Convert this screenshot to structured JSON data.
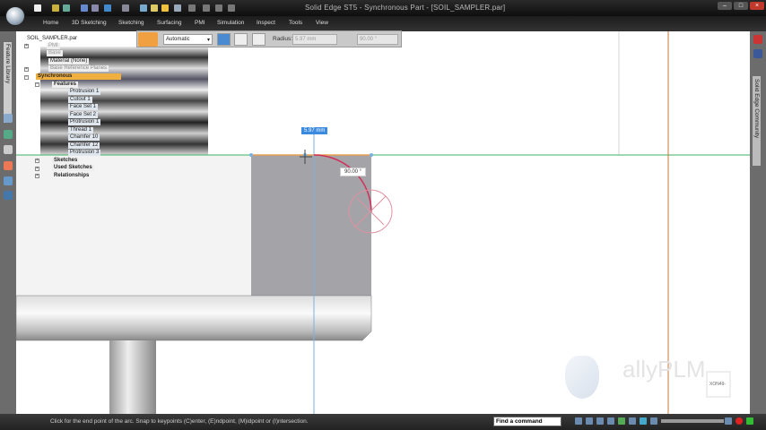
{
  "window": {
    "title": "Solid Edge ST5 - Synchronous Part - [SOIL_SAMPLER.par]"
  },
  "ribbon": {
    "tabs": [
      "Home",
      "3D Sketching",
      "Sketching",
      "Surfacing",
      "PMI",
      "Simulation",
      "Inspect",
      "Tools",
      "View"
    ]
  },
  "command_bar": {
    "mode": "Automatic",
    "radius_label": "Radius:",
    "radius_value": "5.97 mm",
    "angle_value": "90.00 °"
  },
  "left_panel": {
    "tab_label": "Feature Library"
  },
  "right_panel": {
    "tab_label": "Solid Edge Community"
  },
  "tree": {
    "root": "SOIL_SAMPLER.par",
    "pmi": "PMI",
    "base": "Base",
    "material": "Material (None)",
    "ref_planes": "Base Reference Planes",
    "synchronous": "Synchronous",
    "features": "Features",
    "feature_items": [
      "Protrusion 1",
      "Cutout 1",
      "Face Set 1",
      "Face Set 2",
      "Protrusion 1",
      "Thread 1",
      "Chamfer 10",
      "Chamfer 12",
      "Protrusion 3"
    ],
    "sketches": "Sketches",
    "used_sketches": "Used Sketches",
    "relationships": "Relationships"
  },
  "viewport": {
    "dim_radius": "5.97 mm",
    "dim_angle": "90.00 °",
    "watermark": "allyPLM",
    "view_cube": "XON49-"
  },
  "status": {
    "prompt": "Click for the end point of the arc.  Snap to keypoints (C)enter, (E)ndpoint, (M)idpoint or (I)ntersection.",
    "find_command": "Find a command"
  },
  "colors": {
    "accent": "#f0a040",
    "arc": "#d0305a",
    "green_line": "#3cb060",
    "orange_line": "#c87a3a"
  }
}
